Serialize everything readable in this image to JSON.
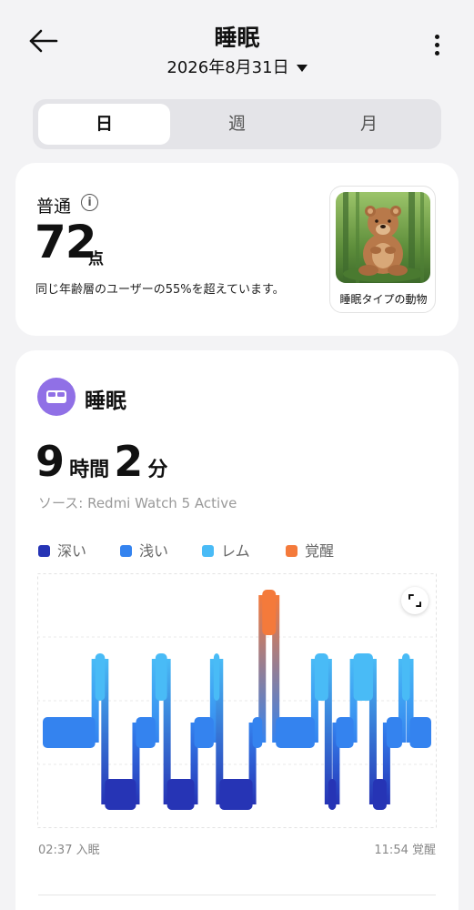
{
  "header": {
    "title": "睡眠",
    "date": "2026年8月31日"
  },
  "tabs": [
    {
      "label": "日",
      "active": true
    },
    {
      "label": "週",
      "active": false
    },
    {
      "label": "月",
      "active": false
    }
  ],
  "score_card": {
    "status": "普通",
    "score": "72",
    "score_unit": "点",
    "comparison": "同じ年齢層のユーザーの55%を超えています。",
    "animal_label": "睡眠タイプの動物"
  },
  "sleep_card": {
    "title": "睡眠",
    "hours": "9",
    "hours_unit": "時間",
    "minutes": "2",
    "minutes_unit": "分",
    "source": "ソース: Redmi Watch 5 Active",
    "legend": [
      {
        "label": "深い",
        "color": "#2634b5"
      },
      {
        "label": "浅い",
        "color": "#3483ef"
      },
      {
        "label": "レム",
        "color": "#49bbf6"
      },
      {
        "label": "覚醒",
        "color": "#f47a3b"
      }
    ],
    "sleep_start": "02:37 入眠",
    "wake_end": "11:54 覚醒"
  },
  "chart_data": {
    "type": "hypnogram",
    "stages": [
      "覚醒",
      "レム",
      "浅い",
      "深い"
    ],
    "x_start": "02:37",
    "x_end": "11:54",
    "segments": [
      {
        "stage": "浅い",
        "start": 0.0,
        "end": 0.135
      },
      {
        "stage": "レム",
        "start": 0.135,
        "end": 0.16
      },
      {
        "stage": "深い",
        "start": 0.16,
        "end": 0.24
      },
      {
        "stage": "浅い",
        "start": 0.24,
        "end": 0.29
      },
      {
        "stage": "レム",
        "start": 0.29,
        "end": 0.32
      },
      {
        "stage": "深い",
        "start": 0.32,
        "end": 0.39
      },
      {
        "stage": "浅い",
        "start": 0.39,
        "end": 0.44
      },
      {
        "stage": "レム",
        "start": 0.44,
        "end": 0.455
      },
      {
        "stage": "深い",
        "start": 0.455,
        "end": 0.54
      },
      {
        "stage": "浅い",
        "start": 0.54,
        "end": 0.565
      },
      {
        "stage": "覚醒",
        "start": 0.565,
        "end": 0.6
      },
      {
        "stage": "浅い",
        "start": 0.6,
        "end": 0.7
      },
      {
        "stage": "レム",
        "start": 0.7,
        "end": 0.735
      },
      {
        "stage": "深い",
        "start": 0.735,
        "end": 0.755
      },
      {
        "stage": "浅い",
        "start": 0.755,
        "end": 0.8
      },
      {
        "stage": "レム",
        "start": 0.8,
        "end": 0.85
      },
      {
        "stage": "深い",
        "start": 0.85,
        "end": 0.885
      },
      {
        "stage": "浅い",
        "start": 0.885,
        "end": 0.925
      },
      {
        "stage": "レム",
        "start": 0.925,
        "end": 0.945
      },
      {
        "stage": "浅い",
        "start": 0.945,
        "end": 1.0
      }
    ]
  }
}
